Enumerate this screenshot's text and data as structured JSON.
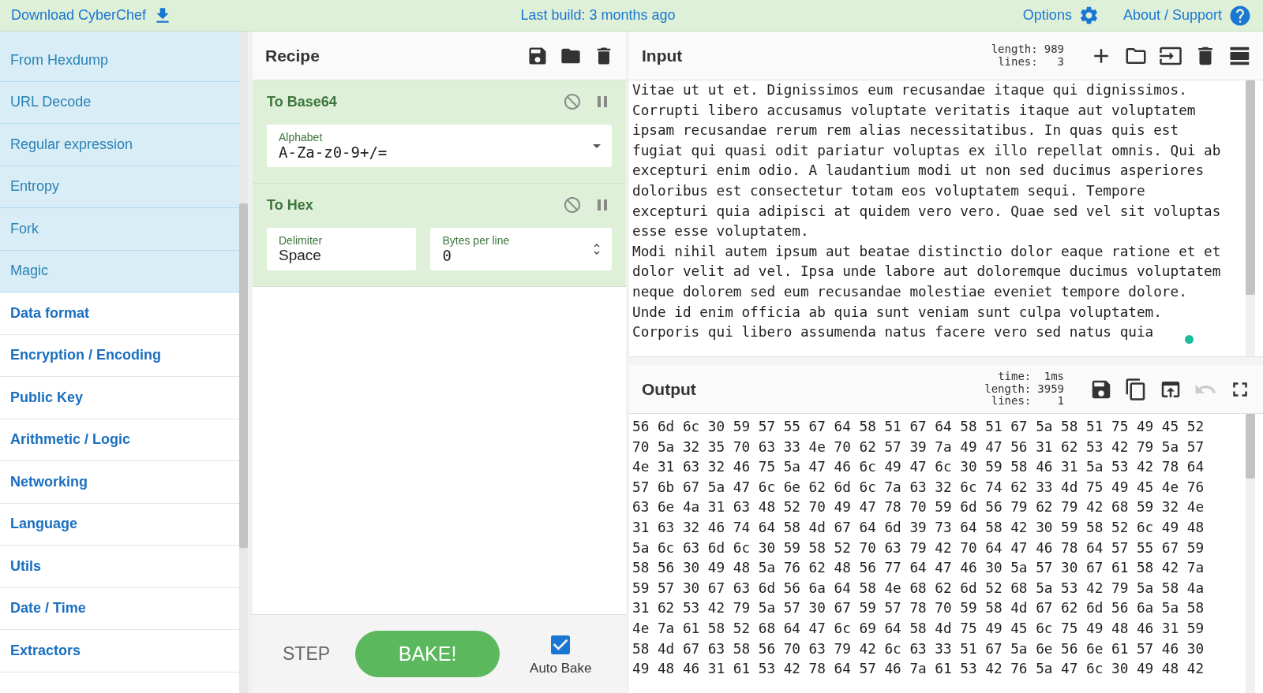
{
  "top_bar": {
    "download": "Download CyberChef",
    "build": "Last build: 3 months ago",
    "options": "Options",
    "about": "About / Support"
  },
  "sidebar": {
    "items": [
      {
        "label": "From Hexdump",
        "kind": "operation"
      },
      {
        "label": "URL Decode",
        "kind": "operation"
      },
      {
        "label": "Regular expression",
        "kind": "operation"
      },
      {
        "label": "Entropy",
        "kind": "operation"
      },
      {
        "label": "Fork",
        "kind": "operation"
      },
      {
        "label": "Magic",
        "kind": "operation"
      },
      {
        "label": "Data format",
        "kind": "category"
      },
      {
        "label": "Encryption / Encoding",
        "kind": "category"
      },
      {
        "label": "Public Key",
        "kind": "category"
      },
      {
        "label": "Arithmetic / Logic",
        "kind": "category"
      },
      {
        "label": "Networking",
        "kind": "category"
      },
      {
        "label": "Language",
        "kind": "category"
      },
      {
        "label": "Utils",
        "kind": "category"
      },
      {
        "label": "Date / Time",
        "kind": "category"
      },
      {
        "label": "Extractors",
        "kind": "category"
      }
    ]
  },
  "recipe": {
    "title": "Recipe",
    "operations": [
      {
        "name": "To Base64",
        "args": [
          {
            "kind": "dropdown",
            "label": "Alphabet",
            "value": "A-Za-z0-9+/="
          }
        ]
      },
      {
        "name": "To Hex",
        "args": [
          {
            "kind": "text",
            "label": "Delimiter",
            "value": "Space"
          },
          {
            "kind": "number",
            "label": "Bytes per line",
            "value": "0"
          }
        ]
      }
    ]
  },
  "controls": {
    "step": "STEP",
    "bake": "BAKE!",
    "auto_bake": {
      "label": "Auto Bake",
      "checked": true
    }
  },
  "input": {
    "title": "Input",
    "stats": [
      {
        "label": "length:",
        "value": "989"
      },
      {
        "label": "lines:",
        "value": "3"
      }
    ],
    "lines": [
      "Vitae ut ut et. Dignissimos eum recusandae itaque qui dignissimos.",
      "Corrupti libero accusamus voluptate veritatis itaque aut voluptatem",
      "ipsam recusandae rerum rem alias necessitatibus. In quas quis est",
      "fugiat qui quasi odit pariatur voluptas ex illo repellat omnis. Qui ab",
      "excepturi enim odio. A laudantium modi ut non sed ducimus asperiores",
      "doloribus est consectetur totam eos voluptatem sequi. Tempore",
      "excepturi quia adipisci at quidem vero vero. Quae sed vel sit voluptas",
      "esse esse voluptatem.",
      "Modi nihil autem ipsum aut beatae distinctio dolor eaque ratione et et",
      "dolor velit ad vel. Ipsa unde labore aut doloremque ducimus voluptatem",
      "neque dolorem sed eum recusandae molestiae eveniet tempore dolore.",
      "Unde id enim officia ab quia sunt veniam sunt culpa voluptatem.",
      "Corporis qui libero assumenda natus facere vero sed natus quia"
    ]
  },
  "output": {
    "title": "Output",
    "undo_disabled": true,
    "stats": [
      {
        "label": "time:",
        "value": "1ms"
      },
      {
        "label": "length:",
        "value": "3959"
      },
      {
        "label": "lines:",
        "value": "1"
      }
    ],
    "lines": [
      "56 6d 6c 30 59 57 55 67 64 58 51 67 64 58 51 67 5a 58 51 75 49 45 52",
      "70 5a 32 35 70 63 33 4e 70 62 57 39 7a 49 47 56 31 62 53 42 79 5a 57",
      "4e 31 63 32 46 75 5a 47 46 6c 49 47 6c 30 59 58 46 31 5a 53 42 78 64",
      "57 6b 67 5a 47 6c 6e 62 6d 6c 7a 63 32 6c 74 62 33 4d 75 49 45 4e 76",
      "63 6e 4a 31 63 48 52 70 49 47 78 70 59 6d 56 79 62 79 42 68 59 32 4e",
      "31 63 32 46 74 64 58 4d 67 64 6d 39 73 64 58 42 30 59 58 52 6c 49 48",
      "5a 6c 63 6d 6c 30 59 58 52 70 63 79 42 70 64 47 46 78 64 57 55 67 59",
      "58 56 30 49 48 5a 76 62 48 56 77 64 47 46 30 5a 57 30 67 61 58 42 7a",
      "59 57 30 67 63 6d 56 6a 64 58 4e 68 62 6d 52 68 5a 53 42 79 5a 58 4a",
      "31 62 53 42 79 5a 57 30 67 59 57 78 70 59 58 4d 67 62 6d 56 6a 5a 58",
      "4e 7a 61 58 52 68 64 47 6c 69 64 58 4d 75 49 45 6c 75 49 48 46 31 59",
      "58 4d 67 63 58 56 70 63 79 42 6c 63 33 51 67 5a 6e 56 6e 61 57 46 30",
      "49 48 46 31 61 53 42 78 64 57 46 7a 61 53 42 76 5a 47 6c 30 49 48 42"
    ]
  }
}
